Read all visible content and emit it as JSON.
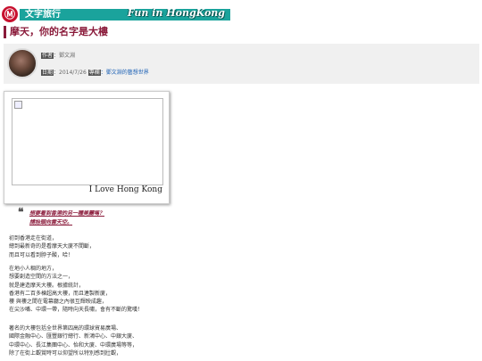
{
  "banner": {
    "logo_glyph": "Ⓜ",
    "title": "文字旅行",
    "english": "Fun in HongKong",
    "color": "#1aa39c"
  },
  "article": {
    "title": "摩天，你的名字是大樓"
  },
  "author": {
    "author_tag": "作者",
    "author_value": "：鄧文淵",
    "date_tag": "日期",
    "date_value": "：2014/7/26 ",
    "source_tag": "專欄",
    "source_link": "：鄧文淵的藝想世界"
  },
  "photo": {
    "caption": "I Love Hong Kong"
  },
  "quote": {
    "lines": [
      "想要看到香港的另一種美麗嗎？",
      "請抬頭向雲天空。"
    ]
  },
  "body": {
    "p1": [
      "初到香港走在街道，",
      "總到最新奇的是看摩天大廈不間斷，",
      "而且可以看到脖子酸，哈！"
    ],
    "p2": [
      "在地小人稠的地方，",
      "想要創造空間的方法之一，",
      "就是建造摩天大樓。根據統計，",
      "香港有二百多棟超高大樓，而且連製新廈，",
      "樓 與樓之間在電幕廳之內很互輝映成趣，",
      "在尖沙嘴、中環一帶，隨時向天長嘯，會有不斷的驚嘆！"
    ],
    "p3": [
      "著名的大樓包括全世界第四高的環球貿易廣場、",
      "國際金融中心、匯豐銀行總行、新鴻中心、中銀大廈、",
      "中環中心、長江集團中心、怡和大廈、中環廣場等等，",
      "除了在街上觀賞時可以仰望所以特別感到壯觀，"
    ]
  }
}
